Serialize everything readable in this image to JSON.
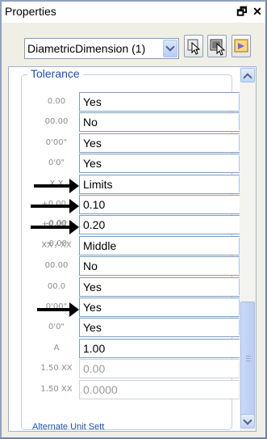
{
  "window": {
    "title": "Properties",
    "pin_glyph": "🗗",
    "close_glyph": "✕"
  },
  "selector": {
    "value": "DiametricDimension (1)"
  },
  "toolbar_icons": [
    "select-objects-icon",
    "quick-select-icon",
    "pickadd-toggle-icon"
  ],
  "group": {
    "title": "Tolerance",
    "partial_next_title": "Alternate Unit Sett"
  },
  "rows": [
    {
      "icon": "0.00",
      "value": "Yes",
      "dropdown": true,
      "disabled": false
    },
    {
      "icon": "00.00",
      "value": "No",
      "dropdown": true,
      "disabled": false
    },
    {
      "icon": "0'00\"",
      "value": "Yes",
      "dropdown": true,
      "disabled": false
    },
    {
      "icon": "0'0\"",
      "value": "Yes",
      "dropdown": true,
      "disabled": false
    },
    {
      "icon": "X.X",
      "value": "Limits",
      "dropdown": true,
      "disabled": false
    },
    {
      "icon": "+0.00 / -0.00",
      "value": "0.10",
      "dropdown": false,
      "disabled": false
    },
    {
      "icon": "+0.00 / -0.00",
      "value": "0.20",
      "dropdown": false,
      "disabled": false
    },
    {
      "icon": "XX / XX",
      "value": "Middle",
      "dropdown": true,
      "disabled": false
    },
    {
      "icon": "00.00",
      "value": "No",
      "dropdown": true,
      "disabled": false
    },
    {
      "icon": "00.0",
      "value": "Yes",
      "dropdown": true,
      "disabled": false
    },
    {
      "icon": "0'00\"",
      "value": "Yes",
      "dropdown": true,
      "disabled": false
    },
    {
      "icon": "0'0\"",
      "value": "Yes",
      "dropdown": true,
      "disabled": false
    },
    {
      "icon": "A",
      "value": "1.00",
      "dropdown": false,
      "disabled": false
    },
    {
      "icon": "1.50 XX",
      "value": "0.00",
      "dropdown": true,
      "disabled": true
    },
    {
      "icon": "1.50 XX",
      "value": "0.0000",
      "dropdown": true,
      "disabled": true
    }
  ],
  "colors": {
    "accent_blue": "#1d4fb5",
    "field_border": "#7f9db9"
  }
}
